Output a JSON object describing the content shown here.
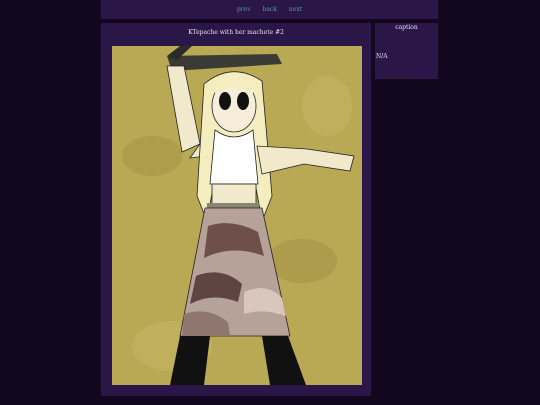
{
  "nav": {
    "prev_label": "prev",
    "back_label": "back",
    "next_label": "next"
  },
  "artwork": {
    "title": "KTepache with her machete #2"
  },
  "caption": {
    "heading": "caption",
    "text": "N/A"
  },
  "colors": {
    "page_bg": "#13071f",
    "panel_bg": "#2a1747",
    "link": "#4f9ab0",
    "text": "#e8e0f0"
  }
}
